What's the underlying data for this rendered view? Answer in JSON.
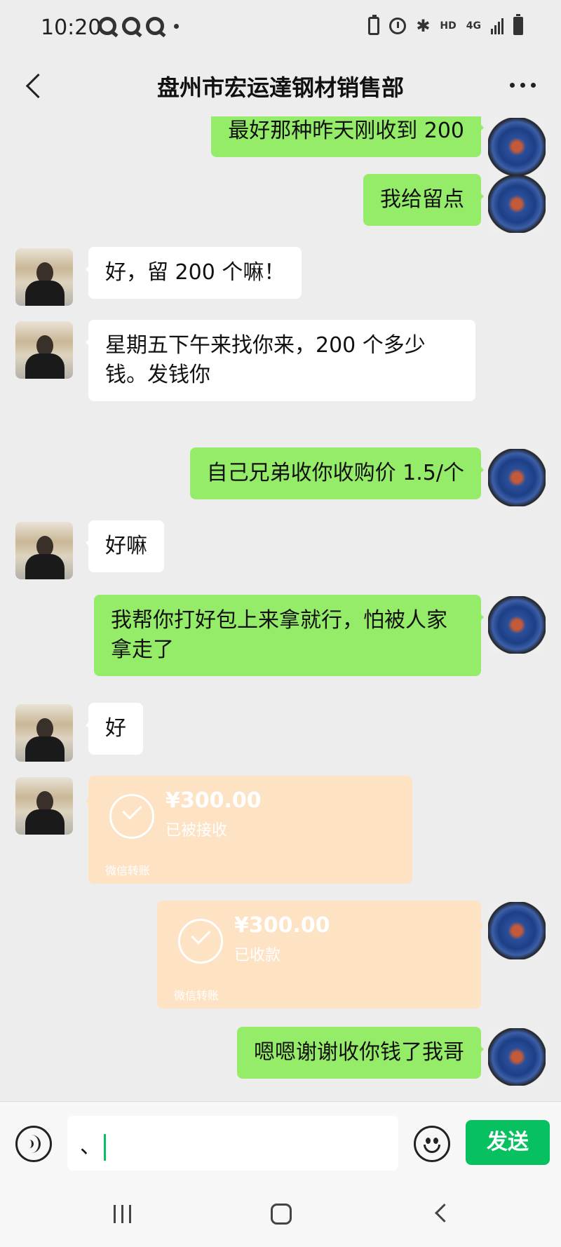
{
  "status_bar": {
    "time": "10:20",
    "network_label": "HD",
    "network_type": "4G",
    "icons": [
      "q-icon",
      "q-icon",
      "q-icon",
      "battery-saver-icon",
      "alarm-icon",
      "bluetooth-icon",
      "signal-icon",
      "battery-icon"
    ]
  },
  "header": {
    "title": "盘州市宏运達钢材销售部",
    "back_icon": "chevron-left-icon",
    "more_icon": "more-dots-icon"
  },
  "messages": [
    {
      "sender": "me",
      "text": "最好那种昨天刚收到 200"
    },
    {
      "sender": "me",
      "text": "我给留点"
    },
    {
      "sender": "other",
      "text": "好，留 200 个嘛！"
    },
    {
      "sender": "other",
      "text": "星期五下午来找你来，200 个多少钱。发钱你"
    },
    {
      "sender": "me",
      "text": "自己兄弟收你收购价 1.5/个"
    },
    {
      "sender": "other",
      "text": "好嘛"
    },
    {
      "sender": "me",
      "text": "我帮你打好包上来拿就行，怕被人家拿走了"
    },
    {
      "sender": "other",
      "text": "好"
    },
    {
      "sender": "other",
      "type": "transfer",
      "amount": "¥300.00",
      "status": "已被接收",
      "label": "微信转账"
    },
    {
      "sender": "me",
      "type": "transfer",
      "amount": "¥300.00",
      "status": "已收款",
      "label": "微信转账"
    },
    {
      "sender": "me",
      "text": "嗯嗯谢谢收你钱了我哥"
    }
  ],
  "input_bar": {
    "value": "、",
    "send_label": "发送",
    "voice_icon": "voice-icon",
    "emoji_icon": "emoji-icon"
  },
  "colors": {
    "my_bubble": "#95ec69",
    "their_bubble": "#ffffff",
    "transfer_card": "#fde2c4",
    "send_button": "#07c160",
    "background": "#ededed"
  }
}
